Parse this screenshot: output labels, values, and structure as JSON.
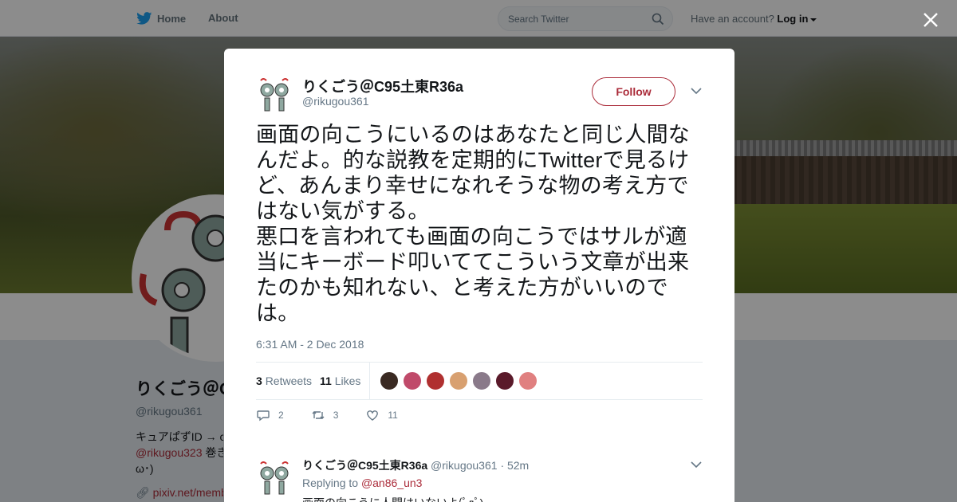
{
  "nav": {
    "home_label": "Home",
    "about_label": "About"
  },
  "search": {
    "placeholder": "Search Twitter"
  },
  "account": {
    "prompt": "Have an account?",
    "login_label": "Log in"
  },
  "profile": {
    "name": "りくごう＠C",
    "handle": "@rikugou361",
    "bio_line1": "キュアぱずID → c",
    "bio_link": "@rikugou323",
    "bio_line2_rest": " 巻き",
    "bio_line3": "ω･)",
    "url": "pixiv.net/memb"
  },
  "tweet": {
    "author_name": "りくごう＠C95土東R36a",
    "author_handle": "@rikugou361",
    "follow_label": "Follow",
    "text": "画面の向こうにいるのはあなたと同じ人間なんだよ。的な説教を定期的にTwitterで見るけど、あんまり幸せになれそうな物の考え方ではない気がする。\n悪口を言われても画面の向こうではサルが適当にキーボード叩いててこういう文章が出来たのかも知れない、と考えた方がいいのでは。",
    "timestamp": "6:31 AM - 2 Dec 2018",
    "retweet_count": "3",
    "retweets_label": "Retweets",
    "like_count": "11",
    "likes_label": "Likes",
    "reply_action_count": "2",
    "retweet_action_count": "3",
    "like_action_count": "11",
    "liker_colors": [
      "#3a2a22",
      "#c04a6a",
      "#b03030",
      "#d8a070",
      "#8a7a8a",
      "#5a1a2a",
      "#e08080"
    ]
  },
  "reply": {
    "author_name": "りくごう＠C95土東R36a",
    "author_handle": "@rikugou361",
    "time": "· 52m",
    "replying_prefix": "Replying to",
    "replying_to": "@an86_un3",
    "text": "画面の向こうに人間はいないよ(ﾟдﾟ)"
  },
  "colors": {
    "accent": "#ab2c3a",
    "twitter_blue": "#1da1f2",
    "muted": "#657786"
  }
}
